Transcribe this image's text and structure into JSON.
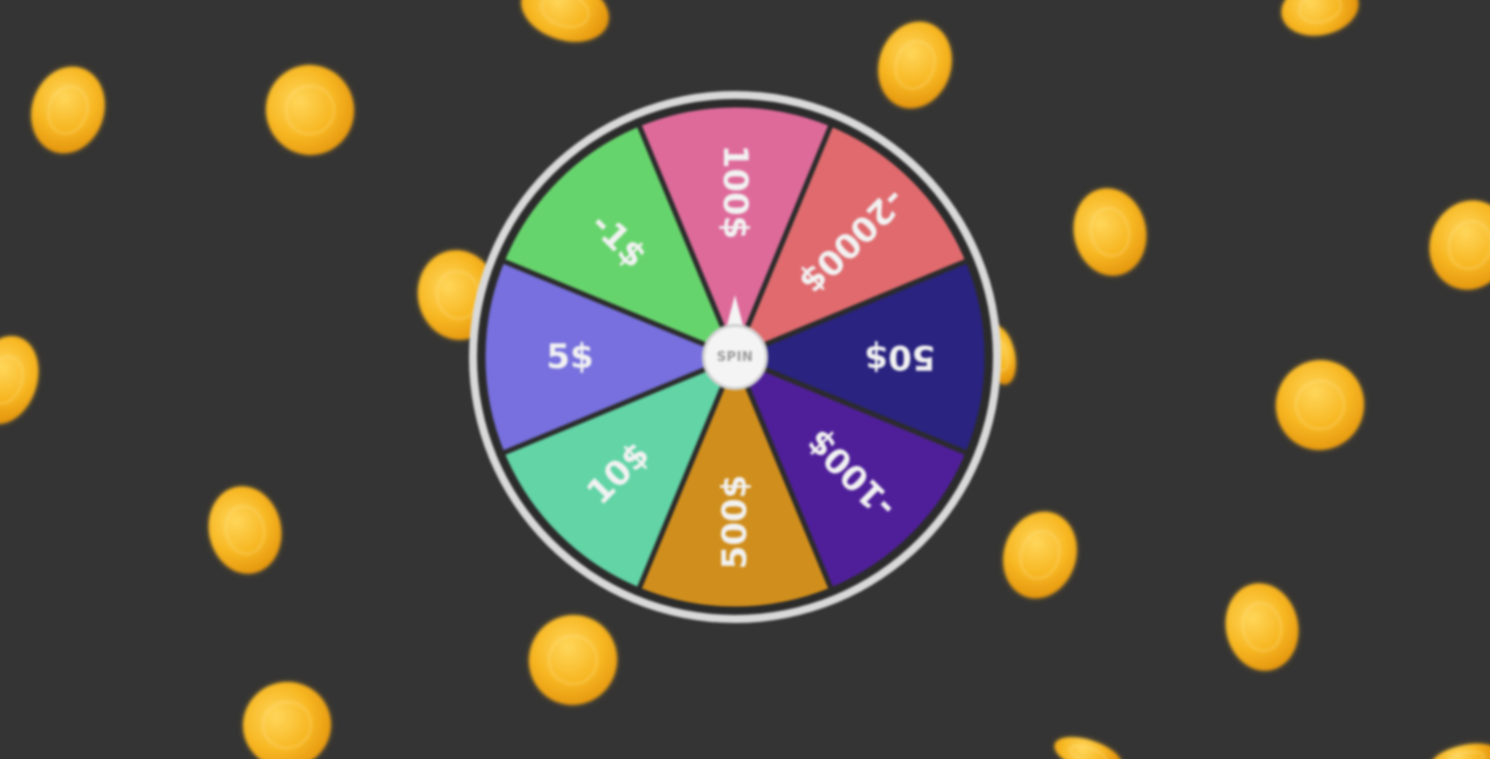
{
  "game": {
    "spin_label": "SPIN",
    "segments": [
      {
        "label": "100$",
        "color": "#de6a9a"
      },
      {
        "label": "-2000$",
        "color": "#e06a6e"
      },
      {
        "label": "50$",
        "color": "#2a2380"
      },
      {
        "label": "-100$",
        "color": "#4f1f9a"
      },
      {
        "label": "500$",
        "color": "#d08e1c"
      },
      {
        "label": "10$",
        "color": "#62d4a6"
      },
      {
        "label": "5$",
        "color": "#7770de"
      },
      {
        "label": "-1$",
        "color": "#66d46c"
      }
    ],
    "colors": {
      "background": "#343434",
      "rim": "#d9d9d9",
      "coin": "#f7b722"
    }
  }
}
